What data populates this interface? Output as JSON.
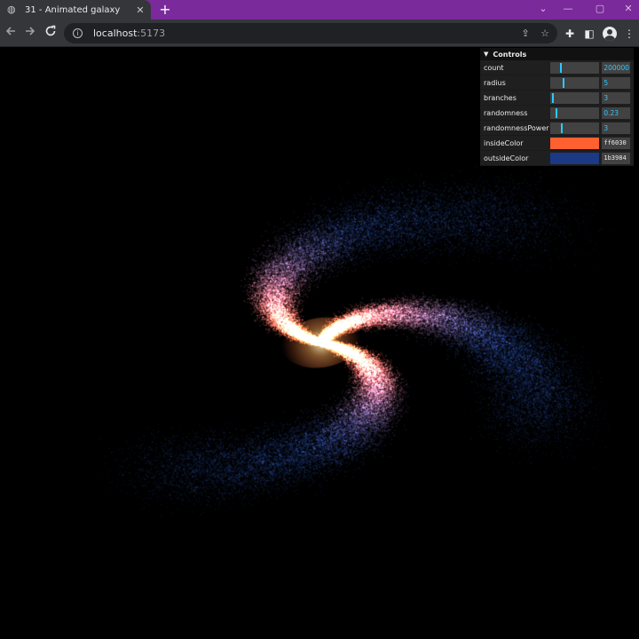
{
  "browser": {
    "tab": {
      "title": "31 - Animated galaxy",
      "close_glyph": "✕"
    },
    "new_tab_glyph": "+",
    "window_controls": [
      "⌄",
      "—",
      "▢",
      "✕"
    ],
    "url": {
      "host": "localhost",
      "port": ":5173"
    }
  },
  "controls": {
    "title": "Controls",
    "params": [
      {
        "label": "count",
        "value": "200000",
        "fill": 0.2
      },
      {
        "label": "radius",
        "value": "5",
        "fill": 0.25
      },
      {
        "label": "branches",
        "value": "3",
        "fill": 0.03
      },
      {
        "label": "randomness",
        "value": "0.23",
        "fill": 0.11
      },
      {
        "label": "randomnessPower",
        "value": "3",
        "fill": 0.22
      }
    ],
    "colors": [
      {
        "label": "insideColor",
        "value": "ff6030",
        "hex": "#ff6030"
      },
      {
        "label": "outsideColor",
        "value": "1b3984",
        "hex": "#1b3984"
      }
    ]
  },
  "theme": {
    "accent": "#2cc9ff",
    "tabbar": "#7a2a9a",
    "toolbar": "#35363a"
  }
}
